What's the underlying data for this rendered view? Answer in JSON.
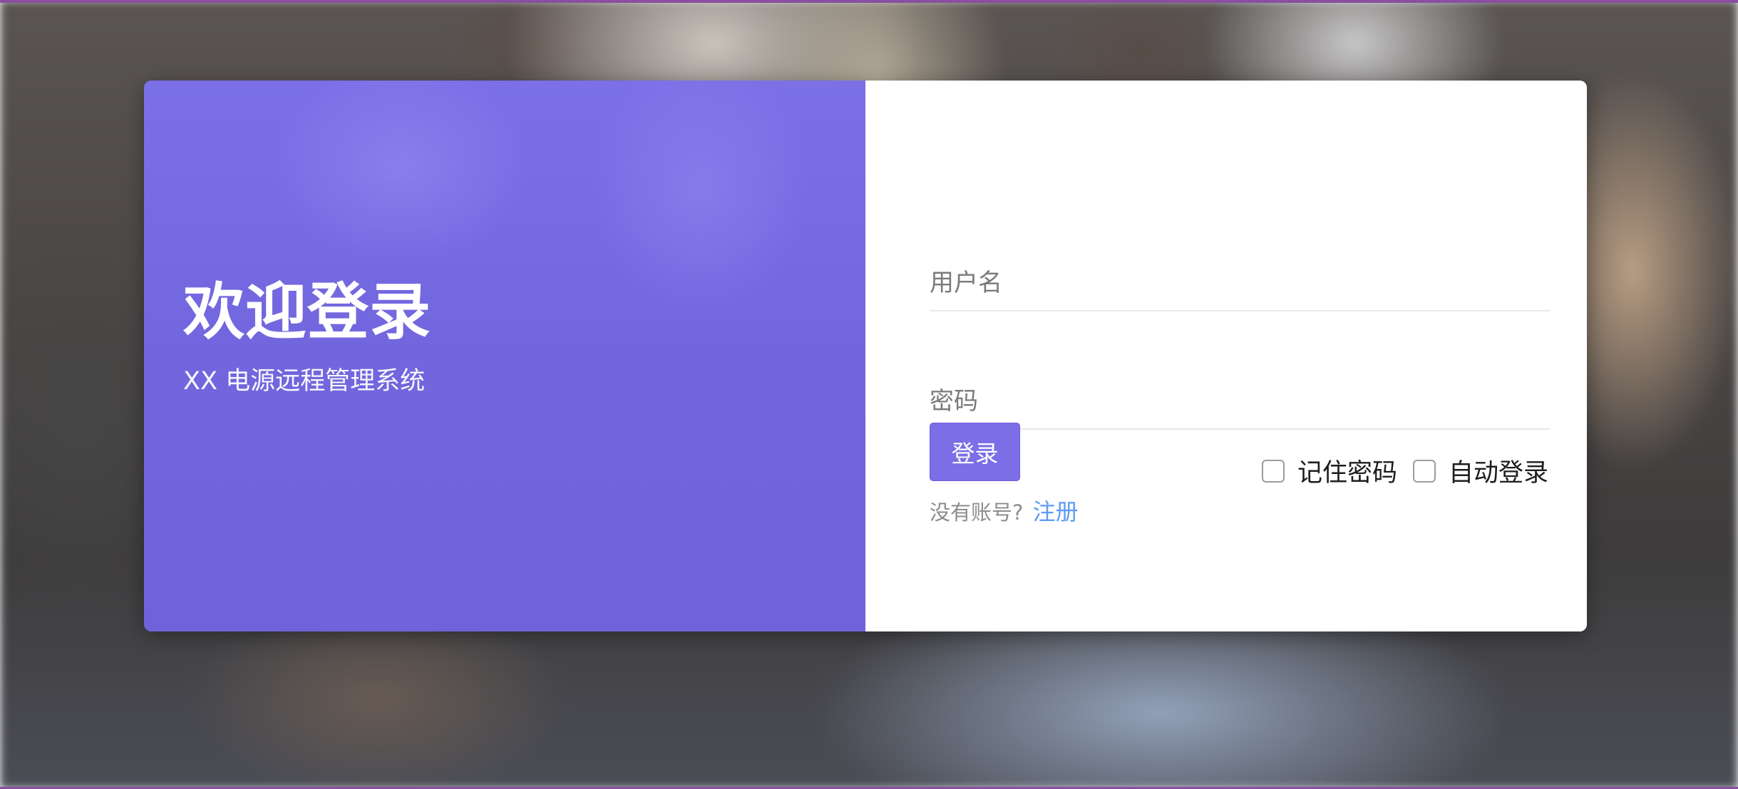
{
  "welcome": {
    "title": "欢迎登录",
    "subtitle": "XX 电源远程管理系统"
  },
  "form": {
    "username_placeholder": "用户名",
    "password_placeholder": "密码",
    "login_button": "登录",
    "remember_password": "记住密码",
    "auto_login": "自动登录",
    "no_account_text": "没有账号?",
    "register_link": "注册"
  },
  "colors": {
    "accent": "#7b6ee6",
    "link": "#5b9bf0",
    "frame": "#8a4fa0"
  }
}
